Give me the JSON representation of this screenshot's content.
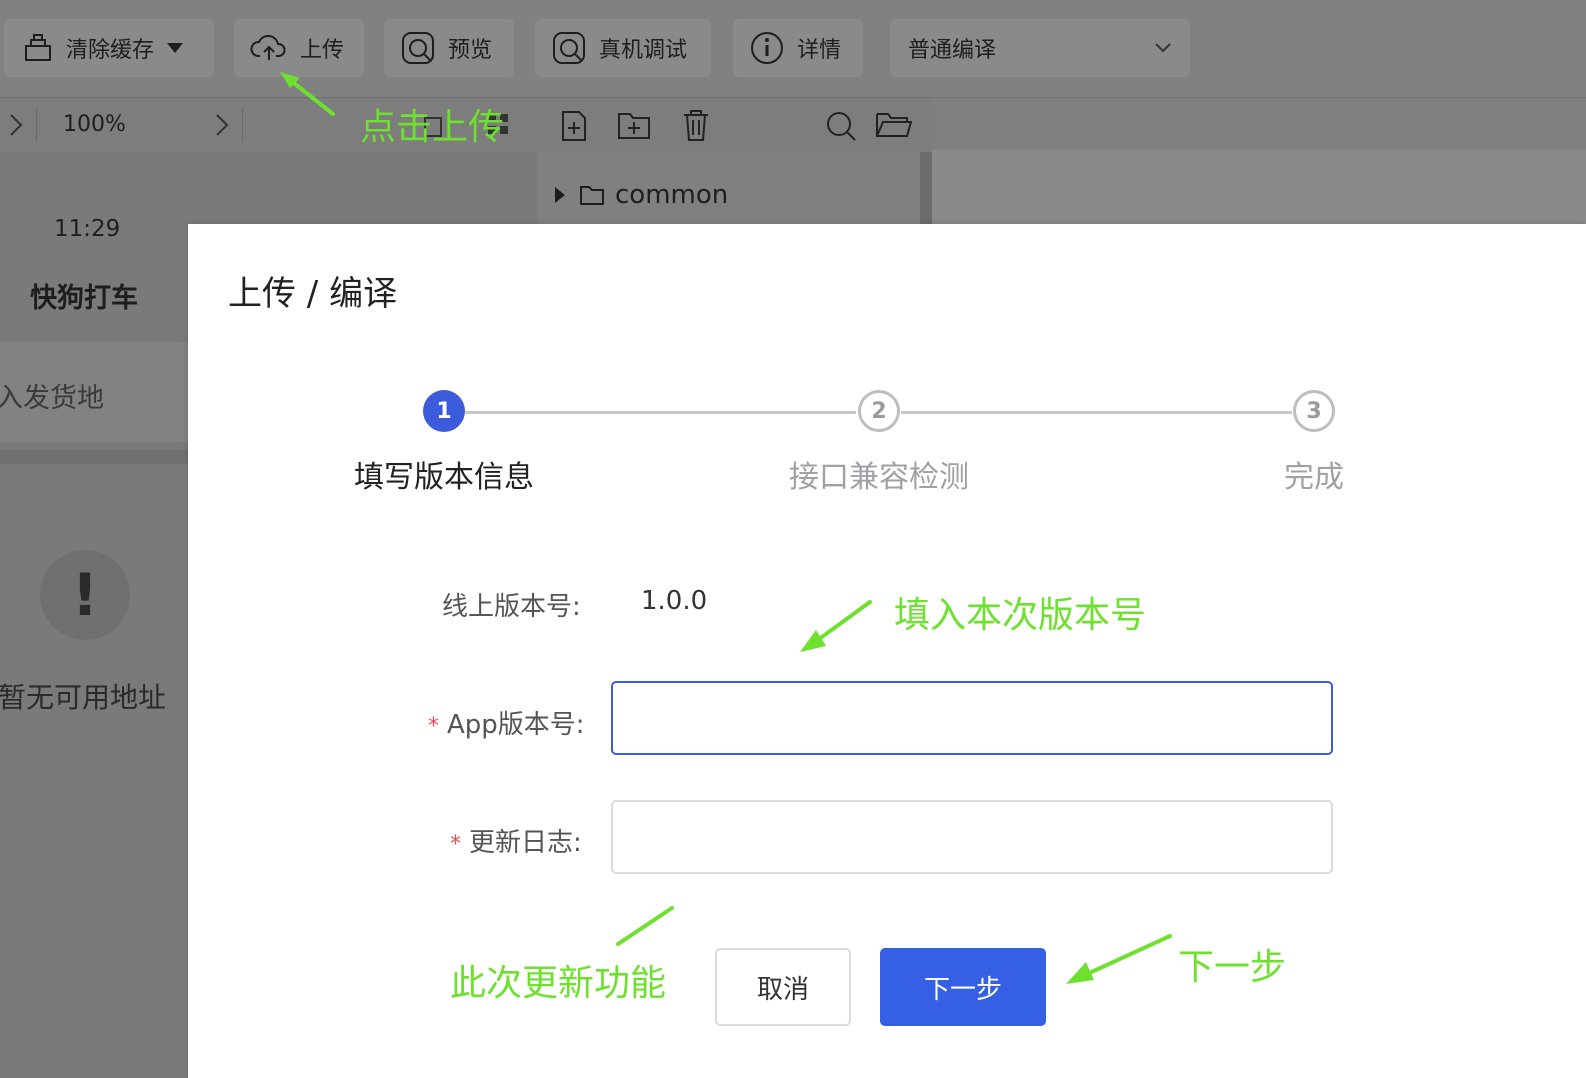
{
  "toolbar": {
    "clear_cache": "清除缓存",
    "upload": "上传",
    "preview": "预览",
    "device_debug": "真机调试",
    "details": "详情",
    "compile_mode": "普通编译"
  },
  "subbar": {
    "zoom": "100%"
  },
  "file_tree": {
    "folder": "common"
  },
  "phone": {
    "time": "11:29",
    "app_title": "快狗打车",
    "placeholder": "入发货地",
    "empty_text": "暂无可用地址",
    "warn_glyph": "!"
  },
  "modal": {
    "title": "上传 / 编译",
    "steps": [
      {
        "number": "1",
        "label": "填写版本信息",
        "state": "active"
      },
      {
        "number": "2",
        "label": "接口兼容检测",
        "state": "pending"
      },
      {
        "number": "3",
        "label": "完成",
        "state": "pending"
      }
    ],
    "online_version_label": "线上版本号:",
    "online_version_value": "1.0.0",
    "app_version_label": "App版本号:",
    "changelog_label": "更新日志:",
    "required_mark": "*",
    "cancel_button": "取消",
    "next_button": "下一步"
  },
  "annotations": {
    "click_upload": "点击上传",
    "fill_version": "填入本次版本号",
    "update_features": "此次更新功能",
    "next_step": "下一步"
  },
  "colors": {
    "primary": "#3660e3",
    "annotation": "#6ee02e",
    "required": "#e34d59"
  }
}
